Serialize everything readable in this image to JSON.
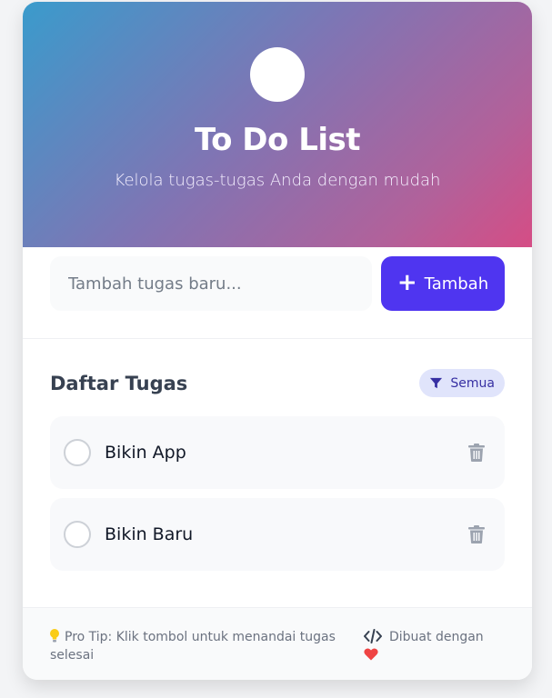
{
  "header": {
    "title": "To Do List",
    "subtitle": "Kelola tugas-tugas Anda dengan mudah",
    "gradient_start": "#3a9bcc",
    "gradient_end": "#d54d85"
  },
  "add_task": {
    "placeholder": "Tambah tugas baru...",
    "value": "",
    "button_label": "Tambah",
    "button_icon": "plus-icon",
    "accent": "#4f35f0"
  },
  "list": {
    "title": "Daftar Tugas",
    "filter": {
      "icon": "filter-icon",
      "label": "Semua"
    },
    "tasks": [
      {
        "label": "Bikin App",
        "completed": false,
        "delete_icon": "trash-icon"
      },
      {
        "label": "Bikin Baru",
        "completed": false,
        "delete_icon": "trash-icon"
      }
    ]
  },
  "footer": {
    "tip_icon": "lightbulb-icon",
    "tip_text": "Pro Tip: Klik tombol untuk menandai tugas selesai",
    "made_icon": "code-icon",
    "made_text": "Dibuat dengan",
    "heart_icon": "heart-icon",
    "heart_color": "#ef4444"
  }
}
